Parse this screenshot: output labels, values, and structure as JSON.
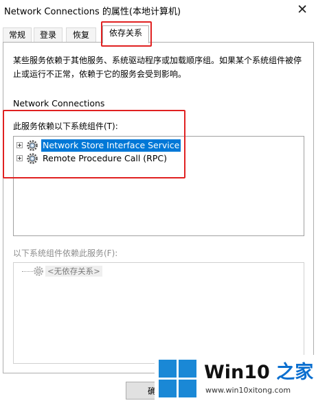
{
  "window": {
    "title": "Network Connections 的属性(本地计算机)",
    "close_glyph": "✕"
  },
  "tabs": [
    {
      "label": "常规",
      "active": false
    },
    {
      "label": "登录",
      "active": false
    },
    {
      "label": "恢复",
      "active": false
    },
    {
      "label": "依存关系",
      "active": true
    }
  ],
  "panel": {
    "description": "某些服务依赖于其他服务、系统驱动程序或加载顺序组。如果某个系统组件被停止或运行不正常，依赖于它的服务会受到影响。",
    "service_name": "Network Connections",
    "depends_on_label": "此服务依赖以下系统组件(T):",
    "depends_on": [
      {
        "label": "Network Store Interface Service",
        "selected": true,
        "icon": "service-gear-icon"
      },
      {
        "label": "Remote Procedure Call (RPC)",
        "selected": false,
        "icon": "service-gear-icon"
      }
    ],
    "dependents_label": "以下系统组件依赖此服务(F):",
    "dependents_empty": "<无依存关系>"
  },
  "buttons": {
    "ok": "确"
  },
  "watermark": {
    "brand_prefix": "Win10",
    "brand_suffix": " 之家",
    "url": "www.win10xitong.com"
  },
  "colors": {
    "selection": "#0078d7",
    "highlight_box": "#e02020",
    "logo_blue": "#1a88d6"
  }
}
